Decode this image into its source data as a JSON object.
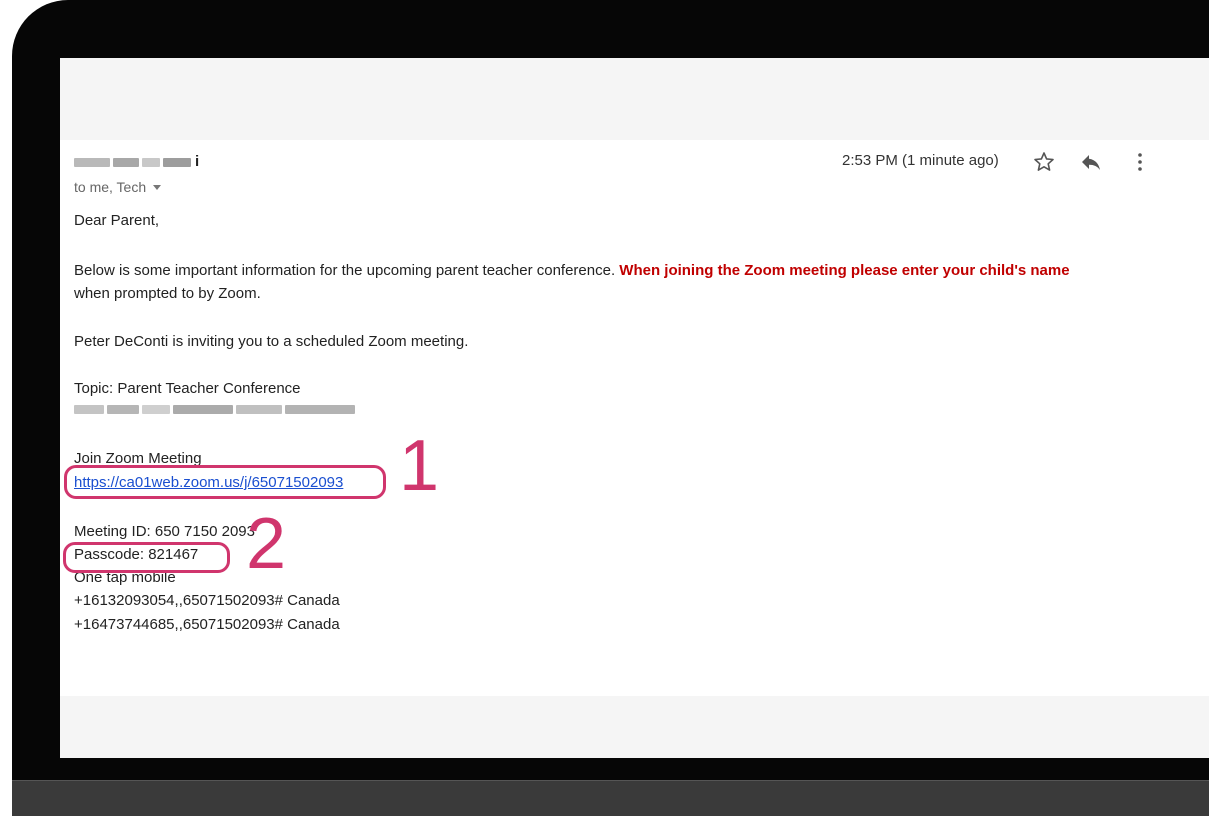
{
  "email": {
    "sender_visible_tail": "i",
    "recipients": "to me, Tech",
    "timestamp": "2:53 PM (1 minute ago)",
    "icons": {
      "star": "star-icon",
      "reply": "reply-icon",
      "more": "more-vert-icon"
    },
    "greeting": "Dear Parent,",
    "para1_text": "Below is some important information for the upcoming parent teacher conference. ",
    "para1_warning": "When joining the Zoom meeting please enter your child's name",
    "para1_cont": "when prompted to by Zoom.",
    "invite": "Peter DeConti is inviting you to a scheduled Zoom meeting.",
    "topic": "Topic: Parent Teacher Conference",
    "join_label": "Join Zoom Meeting",
    "join_link": "https://ca01web.zoom.us/j/65071502093",
    "meeting_id": "Meeting ID: 650 7150 2093",
    "passcode": "Passcode: 821467",
    "one_tap": "One tap mobile",
    "phone1": "+16132093054,,65071502093# Canada",
    "phone2": "+16473744685,,65071502093# Canada"
  },
  "annotations": {
    "callout1": "1",
    "callout2": "2",
    "color": "#d0356d"
  },
  "colors": {
    "warning": "#c00000",
    "link": "#1a4fd0"
  }
}
